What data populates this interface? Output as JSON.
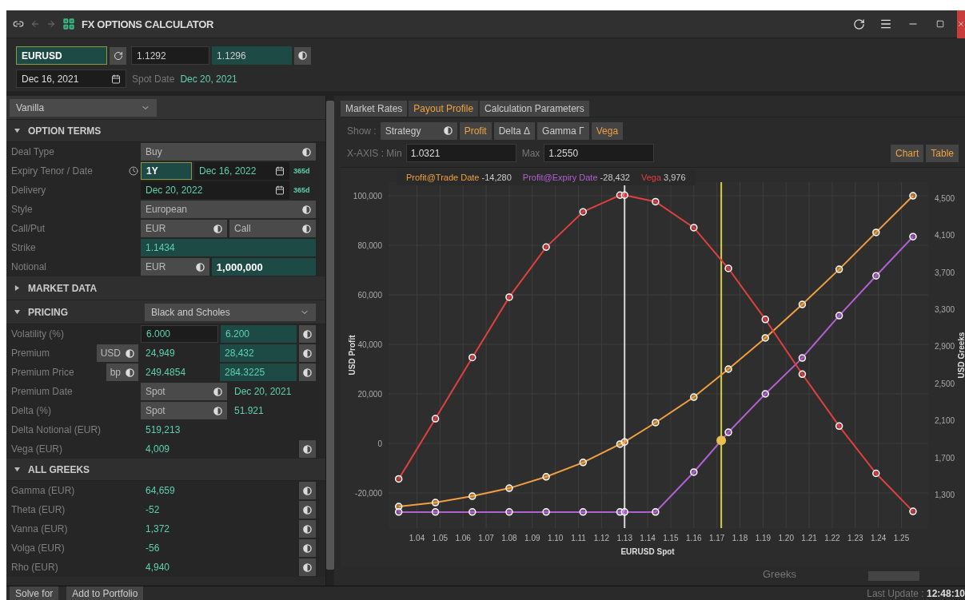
{
  "window": {
    "title": "FX OPTIONS CALCULATOR"
  },
  "quote": {
    "pair": "EURUSD",
    "bid": "1.1292",
    "ask": "1.1296",
    "trade_date": "Dec 16, 2021",
    "spot_date_label": "Spot Date",
    "spot_date": "Dec 20, 2021"
  },
  "product": {
    "value": "Vanilla"
  },
  "sections": [
    {
      "title": "OPTION TERMS",
      "expanded": true,
      "rows": [
        {
          "label": "Deal Type",
          "cells": [
            {
              "kind": "select",
              "value": "Buy"
            }
          ]
        },
        {
          "label": "Expiry Tenor / Date",
          "clock": true,
          "days": "365d",
          "cells": [
            {
              "kind": "tenor",
              "value": "1Y"
            },
            {
              "kind": "date",
              "value": "Dec 16, 2022"
            }
          ]
        },
        {
          "label": "Delivery",
          "days": "365d",
          "cells": [
            {
              "kind": "date",
              "value": "Dec 20, 2022"
            }
          ]
        },
        {
          "label": "Style",
          "cells": [
            {
              "kind": "select",
              "value": "European"
            }
          ]
        },
        {
          "label": "Call/Put",
          "cells": [
            {
              "kind": "select",
              "value": "EUR"
            },
            {
              "kind": "select",
              "value": "Call"
            }
          ]
        },
        {
          "label": "Strike",
          "cells": [
            {
              "kind": "highlight",
              "value": "1.1434"
            }
          ]
        },
        {
          "label": "Notional",
          "cells": [
            {
              "kind": "select",
              "value": "EUR"
            },
            {
              "kind": "strong",
              "value": "1,000,000"
            }
          ]
        }
      ]
    },
    {
      "title": "MARKET DATA",
      "expanded": false
    },
    {
      "title": "PRICING",
      "expanded": true,
      "model": "Black and Scholes",
      "rows": [
        {
          "label": "Volatility (%)",
          "action": true,
          "cells": [
            {
              "kind": "input",
              "value": "6.000"
            },
            {
              "kind": "highlight",
              "value": "6.200"
            }
          ]
        },
        {
          "label": "Premium",
          "unit": "USD",
          "action": true,
          "cells": [
            {
              "kind": "text",
              "value": "24,949"
            },
            {
              "kind": "highlight",
              "value": "28,432"
            }
          ]
        },
        {
          "label": "Premium Price",
          "unit": "bp",
          "action": true,
          "cells": [
            {
              "kind": "text",
              "value": "249.4854"
            },
            {
              "kind": "highlight",
              "value": "284.3225"
            }
          ]
        },
        {
          "label": "Premium Date",
          "cells": [
            {
              "kind": "select",
              "value": "Spot"
            },
            {
              "kind": "text",
              "value": "Dec 20, 2021"
            }
          ]
        },
        {
          "label": "Delta (%)",
          "cells": [
            {
              "kind": "select",
              "value": "Spot"
            },
            {
              "kind": "text",
              "value": "51.921"
            }
          ]
        },
        {
          "label": "Delta Notional (EUR)",
          "cells": [
            {
              "kind": "text",
              "value": "519,213"
            }
          ]
        },
        {
          "label": "Vega (EUR)",
          "action": true,
          "cells": [
            {
              "kind": "text",
              "value": "4,009"
            }
          ]
        }
      ]
    },
    {
      "title": "ALL GREEKS",
      "expanded": true,
      "rows": [
        {
          "label": "Gamma (EUR)",
          "action": true,
          "cells": [
            {
              "kind": "text",
              "value": "64,659"
            }
          ]
        },
        {
          "label": "Theta (EUR)",
          "action": true,
          "cells": [
            {
              "kind": "text",
              "value": "-52"
            }
          ]
        },
        {
          "label": "Vanna (EUR)",
          "action": true,
          "cells": [
            {
              "kind": "text",
              "value": "1,372"
            }
          ]
        },
        {
          "label": "Volga (EUR)",
          "action": true,
          "cells": [
            {
              "kind": "text",
              "value": "-56"
            }
          ]
        },
        {
          "label": "Rho (EUR)",
          "action": true,
          "cells": [
            {
              "kind": "text",
              "value": "4,940"
            }
          ]
        }
      ]
    }
  ],
  "tabs": [
    {
      "label": "Market Rates",
      "selected": false
    },
    {
      "label": "Payout Profile",
      "selected": true
    },
    {
      "label": "Calculation Parameters",
      "selected": false
    }
  ],
  "show": {
    "label": "Show :",
    "strategy": "Strategy",
    "toggles": [
      {
        "label": "Profit",
        "on": true
      },
      {
        "label": "Delta Δ",
        "on": false
      },
      {
        "label": "Gamma Γ",
        "on": false
      },
      {
        "label": "Vega",
        "on": true
      }
    ]
  },
  "x_axis": {
    "min_label": "X-AXIS : Min",
    "min": "1.0321",
    "max_label": "Max",
    "max": "1.2550"
  },
  "views": [
    "Chart",
    "Table"
  ],
  "legend_values": [
    "-14,280",
    "-28,432",
    "3,976"
  ],
  "chart_data": {
    "type": "line",
    "xlabel": "EURUSD Spot",
    "ylabel": "USD Profit",
    "y2label": "USD Greeks",
    "x": [
      1.0321,
      1.048,
      1.064,
      1.08,
      1.096,
      1.112,
      1.128,
      1.13,
      1.1434,
      1.16,
      1.175,
      1.191,
      1.207,
      1.223,
      1.239,
      1.255
    ],
    "xlim": [
      1.0277,
      1.2616
    ],
    "ylim": [
      -34200,
      105500
    ],
    "y2lim": [
      940,
      4670
    ],
    "xticks": [
      {
        "value": 1.04,
        "label": "1.04"
      },
      {
        "value": 1.05,
        "label": "1.05"
      },
      {
        "value": 1.06,
        "label": "1.06"
      },
      {
        "value": 1.07,
        "label": "1.07"
      },
      {
        "value": 1.08,
        "label": "1.08"
      },
      {
        "value": 1.09,
        "label": "1.09"
      },
      {
        "value": 1.1,
        "label": "1.10"
      },
      {
        "value": 1.11,
        "label": "1.11"
      },
      {
        "value": 1.12,
        "label": "1.12"
      },
      {
        "value": 1.13,
        "label": "1.13"
      },
      {
        "value": 1.14,
        "label": "1.14"
      },
      {
        "value": 1.15,
        "label": "1.15"
      },
      {
        "value": 1.16,
        "label": "1.16"
      },
      {
        "value": 1.17,
        "label": "1.17"
      },
      {
        "value": 1.18,
        "label": "1.18"
      },
      {
        "value": 1.19,
        "label": "1.19"
      },
      {
        "value": 1.2,
        "label": "1.20"
      },
      {
        "value": 1.21,
        "label": "1.21"
      },
      {
        "value": 1.22,
        "label": "1.22"
      },
      {
        "value": 1.23,
        "label": "1.23"
      },
      {
        "value": 1.24,
        "label": "1.24"
      },
      {
        "value": 1.25,
        "label": "1.25"
      }
    ],
    "yticks": [
      {
        "value": -20000,
        "label": "-20,000"
      },
      {
        "value": 0,
        "label": "0"
      },
      {
        "value": 20000,
        "label": "20,000"
      },
      {
        "value": 40000,
        "label": "40,000"
      },
      {
        "value": 60000,
        "label": "60,000"
      },
      {
        "value": 80000,
        "label": "80,000"
      },
      {
        "value": 100000,
        "label": "100,000"
      }
    ],
    "y2ticks": [
      {
        "value": 1300,
        "label": "1,300"
      },
      {
        "value": 1700,
        "label": "1,700"
      },
      {
        "value": 2100,
        "label": "2,100"
      },
      {
        "value": 2500,
        "label": "2,500"
      },
      {
        "value": 2900,
        "label": "2,900"
      },
      {
        "value": 3300,
        "label": "3,300"
      },
      {
        "value": 3700,
        "label": "3,700"
      },
      {
        "value": 4100,
        "label": "4,100"
      },
      {
        "value": 4500,
        "label": "4,500"
      }
    ],
    "series": [
      {
        "name": "Profit@Trade Date",
        "color": "#f0a040",
        "marker": "o",
        "values": [
          -25500,
          -23900,
          -21300,
          -18100,
          -13500,
          -7700,
          -300,
          600,
          8400,
          18700,
          30000,
          42600,
          56100,
          70300,
          85200,
          100000
        ]
      },
      {
        "name": "Profit@Expiry Date",
        "color": "#b060d0",
        "marker": "o",
        "values": [
          -27700,
          -27700,
          -27700,
          -27700,
          -27700,
          -27700,
          -27700,
          -27700,
          -27700,
          -11600,
          4500,
          20000,
          34500,
          51600,
          67700,
          83500
        ]
      },
      {
        "name": "Vega",
        "color": "#e04040",
        "axis": "y2",
        "marker": "o",
        "values": [
          1470,
          2120,
          2780,
          3430,
          3970,
          4350,
          4530,
          4530,
          4460,
          4180,
          3740,
          3190,
          2600,
          2040,
          1530,
          1120
        ]
      }
    ],
    "grid": true,
    "ref_lines": [
      {
        "axis": "x",
        "value": 1.13,
        "color": "#d8d8d8"
      },
      {
        "axis": "x",
        "value": 1.1719,
        "color": "#d8d040"
      }
    ]
  },
  "footer": {
    "greeks_label": "Greeks"
  },
  "bottom": {
    "buttons": [
      "Solve for",
      "Add to Portfolio"
    ],
    "last_update_label": "Last Update :",
    "last_update": "12:48:10"
  }
}
